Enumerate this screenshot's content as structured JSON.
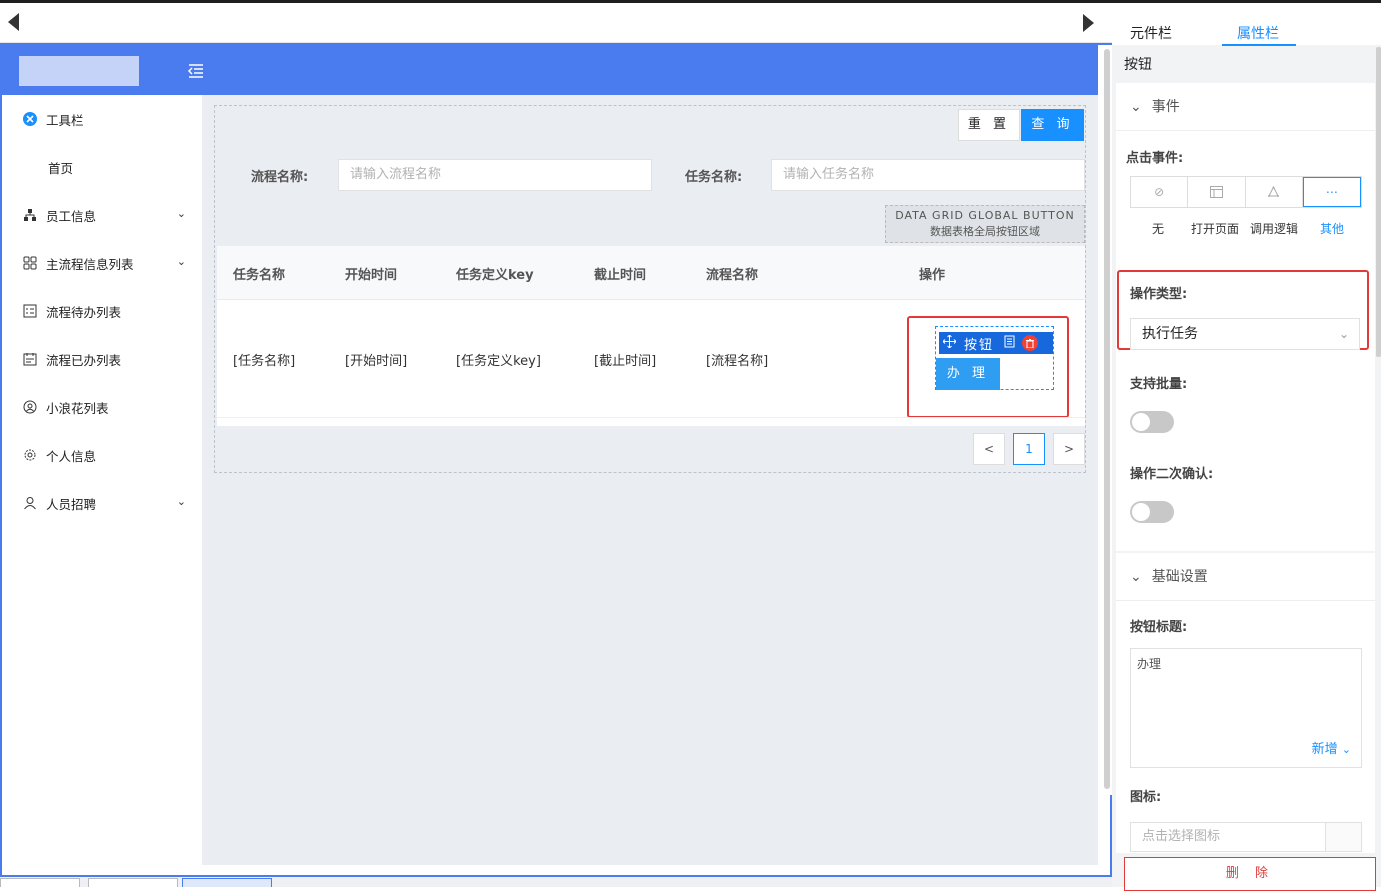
{
  "right_panel": {
    "tabs": [
      "元件栏",
      "属性栏"
    ],
    "component_title": "按钮",
    "events_section": "事件",
    "click_event_label": "点击事件:",
    "event_options": [
      "无",
      "打开页面",
      "调用逻辑",
      "其他"
    ],
    "op_type_label": "操作类型:",
    "op_type_value": "执行任务",
    "batch_label": "支持批量:",
    "confirm_label": "操作二次确认:",
    "basic_section": "基础设置",
    "btn_title_label": "按钮标题:",
    "btn_title_value": "办理",
    "add_link": "新增",
    "icon_label": "图标:",
    "icon_placeholder": "点击选择图标",
    "delete_button": "删 除"
  },
  "sidebar": {
    "items": [
      {
        "label": "工具栏",
        "icon": "tools-icon"
      },
      {
        "label": "首页",
        "icon": ""
      },
      {
        "label": "员工信息",
        "icon": "org-icon",
        "expandable": true
      },
      {
        "label": "主流程信息列表",
        "icon": "grid-icon",
        "expandable": true
      },
      {
        "label": "流程待办列表",
        "icon": "checklist-icon"
      },
      {
        "label": "流程已办列表",
        "icon": "calendar-icon"
      },
      {
        "label": "小浪花列表",
        "icon": "user-circle-icon"
      },
      {
        "label": "个人信息",
        "icon": "gear-icon"
      },
      {
        "label": "人员招聘",
        "icon": "person-icon",
        "expandable": true
      }
    ]
  },
  "search": {
    "reset": "重 置",
    "query": "查 询",
    "flow_name_label": "流程名称:",
    "flow_name_placeholder": "请输入流程名称",
    "task_name_label": "任务名称:",
    "task_name_placeholder": "请输入任务名称"
  },
  "global_button_area": {
    "en": "DATA GRID GLOBAL BUTTON",
    "cn": "数据表格全局按钮区域"
  },
  "table": {
    "headers": [
      "任务名称",
      "开始时间",
      "任务定义key",
      "截止时间",
      "流程名称",
      "操作"
    ],
    "row": [
      "[任务名称]",
      "[开始时间]",
      "[任务定义key]",
      "[截止时间]",
      "[流程名称]"
    ],
    "selected_toolbar_label": "按钮",
    "action_button": "办 理"
  },
  "pagination": {
    "prev": "<",
    "current": "1",
    "next": ">"
  },
  "colors": {
    "accent": "#1890ff",
    "header_bg": "#4a7cf0",
    "highlight": "#e23a3a"
  }
}
